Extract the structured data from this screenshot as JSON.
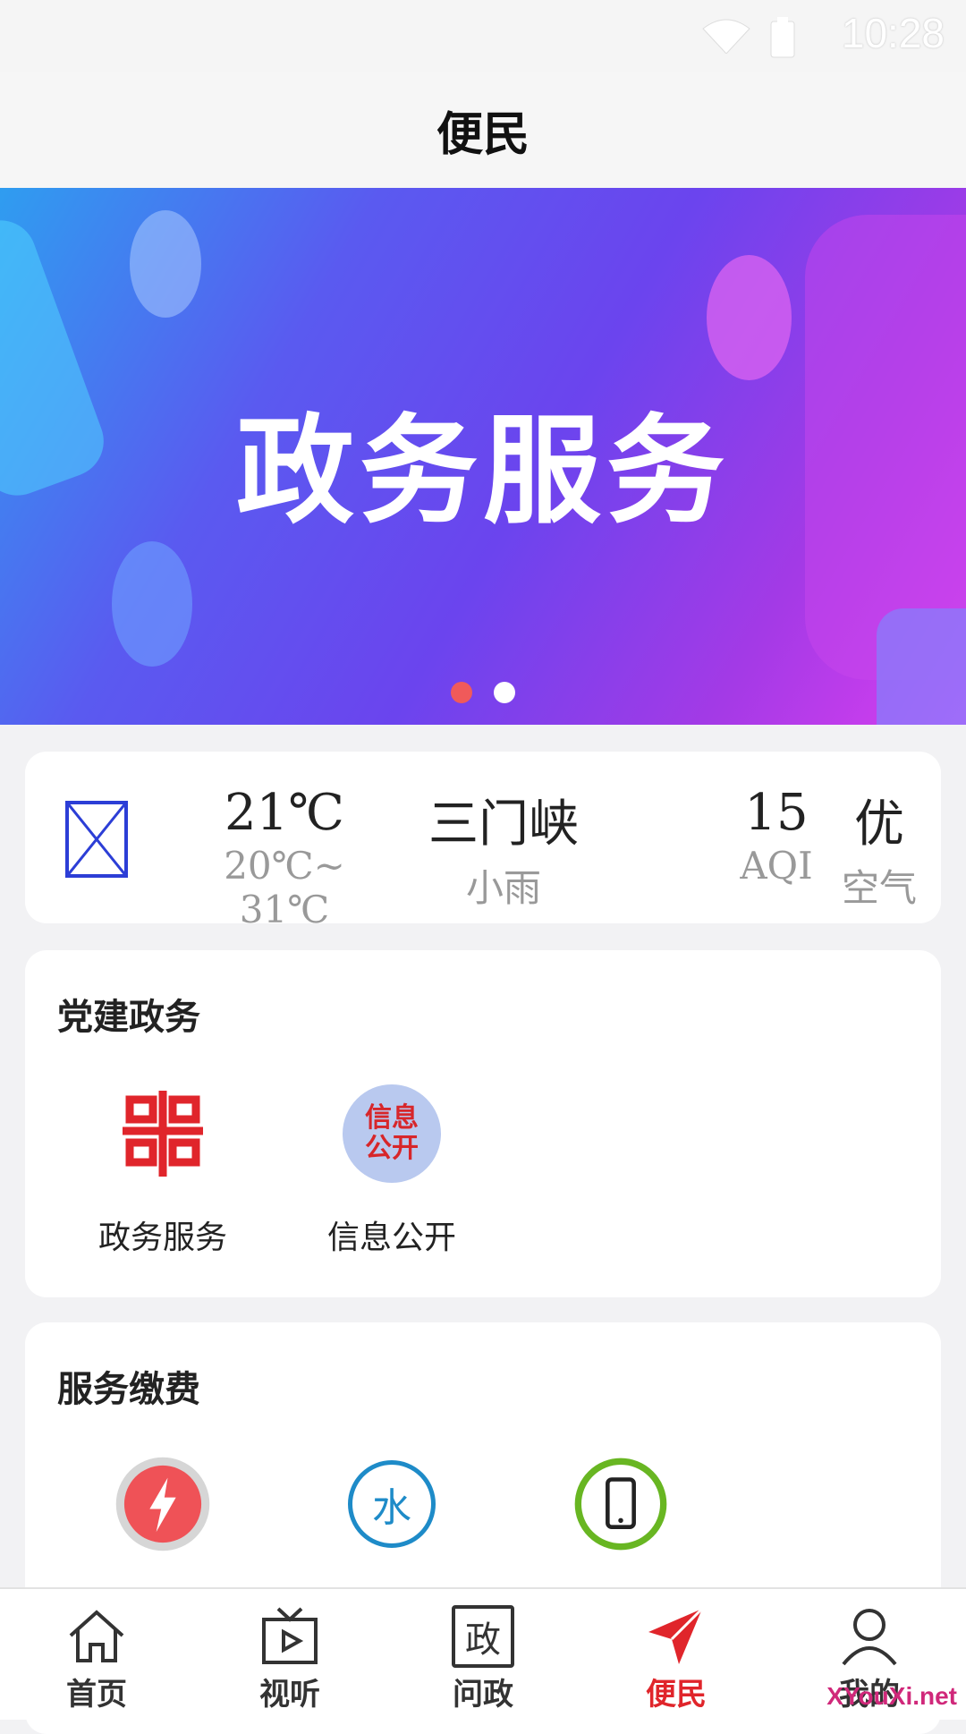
{
  "status_bar": {
    "time": "10:28"
  },
  "header": {
    "title": "便民"
  },
  "banner": {
    "headline": "政务服务",
    "page_count": 2,
    "active_page": 1
  },
  "weather": {
    "temp": "21℃",
    "range": "20℃~ 31℃",
    "city": "三门峡",
    "condition": "小雨",
    "aqi_value": "15",
    "aqi_label": "AQI",
    "air_quality": "优",
    "air_label": "空气"
  },
  "party_section": {
    "title": "党建政务",
    "items": [
      {
        "label": "政务服务",
        "icon": "government-service-icon"
      },
      {
        "label": "信息公开",
        "icon": "info-disclosure-icon",
        "icon_text_1": "信息",
        "icon_text_2": "公开"
      }
    ]
  },
  "fees_section": {
    "title": "服务缴费",
    "items": [
      {
        "icon": "electricity-icon"
      },
      {
        "icon": "water-icon",
        "icon_text": "水"
      },
      {
        "icon": "mobile-phone-icon"
      }
    ]
  },
  "tabbar": {
    "tabs": [
      {
        "label": "首页",
        "icon": "home-icon"
      },
      {
        "label": "视听",
        "icon": "tv-play-icon"
      },
      {
        "label": "问政",
        "icon": "inquiry-icon",
        "icon_text": "政"
      },
      {
        "label": "便民",
        "icon": "send-icon",
        "active": true
      },
      {
        "label": "我的",
        "icon": "user-icon"
      }
    ]
  },
  "watermark": "XYouXi.net",
  "colors": {
    "accent": "#e0252b",
    "banner_start": "#2f9df0",
    "banner_end": "#d93ff0"
  }
}
